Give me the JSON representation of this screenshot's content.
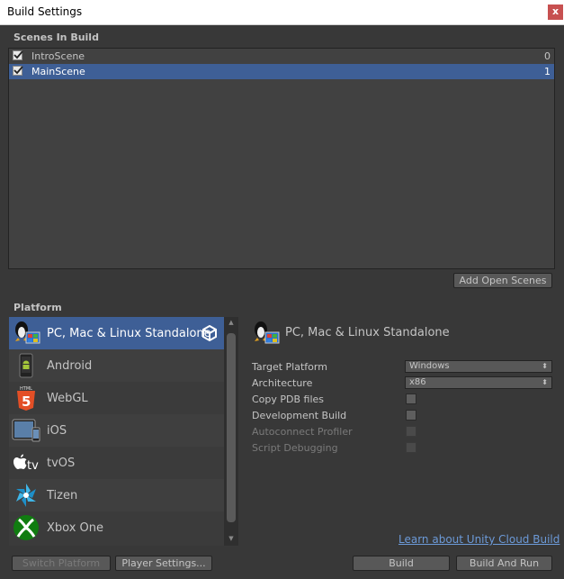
{
  "window": {
    "title": "Build Settings",
    "close_glyph": "x"
  },
  "scenes": {
    "label": "Scenes In Build",
    "items": [
      {
        "name": "IntroScene",
        "index": "0",
        "checked": true
      },
      {
        "name": "MainScene",
        "index": "1",
        "checked": true
      }
    ],
    "add_open_scenes_label": "Add Open Scenes"
  },
  "platform": {
    "label": "Platform",
    "items": [
      {
        "label": "PC, Mac & Linux Standalone",
        "icon": "pc-mac-linux-icon"
      },
      {
        "label": "Android",
        "icon": "android-icon"
      },
      {
        "label": "WebGL",
        "icon": "html5-icon"
      },
      {
        "label": "iOS",
        "icon": "ios-device-icon"
      },
      {
        "label": "tvOS",
        "icon": "apple-tv-icon"
      },
      {
        "label": "Tizen",
        "icon": "tizen-icon"
      },
      {
        "label": "Xbox One",
        "icon": "xbox-icon"
      }
    ],
    "selected": "PC, Mac & Linux Standalone"
  },
  "details": {
    "title": "PC, Mac & Linux Standalone",
    "target_platform_label": "Target Platform",
    "target_platform_value": "Windows",
    "architecture_label": "Architecture",
    "architecture_value": "x86",
    "copy_pdb_label": "Copy PDB files",
    "development_build_label": "Development Build",
    "autoconnect_profiler_label": "Autoconnect Profiler",
    "script_debugging_label": "Script Debugging"
  },
  "footer": {
    "cloud_build_link": "Learn about Unity Cloud Build",
    "switch_platform_label": "Switch Platform",
    "player_settings_label": "Player Settings...",
    "build_label": "Build",
    "build_and_run_label": "Build And Run"
  },
  "colors": {
    "selection": "#3e5f96",
    "background": "#383838",
    "link": "#6c9ad8",
    "close": "#c75050"
  }
}
